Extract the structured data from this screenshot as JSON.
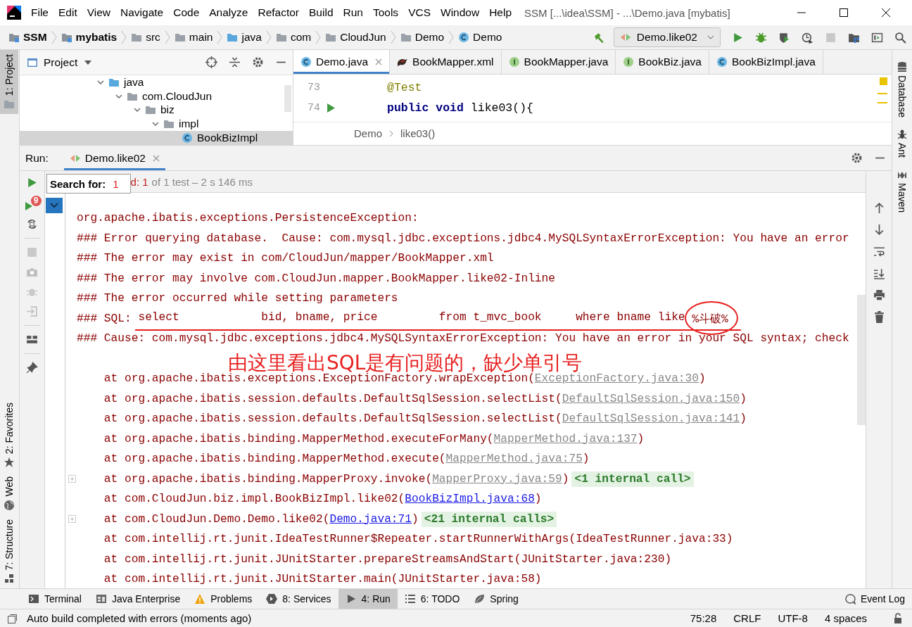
{
  "titlebar": {
    "menu": [
      "File",
      "Edit",
      "View",
      "Navigate",
      "Code",
      "Analyze",
      "Refactor",
      "Build",
      "Run",
      "Tools",
      "VCS",
      "Window",
      "Help"
    ],
    "title": "SSM [...\\idea\\SSM] - ...\\Demo.java [mybatis]"
  },
  "navbar": {
    "crumbs": [
      {
        "label": "SSM",
        "bold": true
      },
      {
        "label": "mybatis",
        "bold": true
      },
      {
        "label": "src",
        "bold": false
      },
      {
        "label": "main",
        "bold": false
      },
      {
        "label": "java",
        "bold": false
      },
      {
        "label": "com",
        "bold": false
      },
      {
        "label": "CloudJun",
        "bold": false
      },
      {
        "label": "Demo",
        "bold": false
      },
      {
        "label": "Demo",
        "bold": false
      }
    ],
    "run_config": "Demo.like02"
  },
  "project_panel": {
    "title": "Project",
    "tree": [
      {
        "label": "java",
        "expanded": true,
        "children": [
          {
            "label": "com.CloudJun",
            "expanded": true,
            "children": [
              {
                "label": "biz",
                "expanded": true,
                "children": [
                  {
                    "label": "impl",
                    "expanded": true,
                    "children": [
                      {
                        "label": "BookBizImpl"
                      }
                    ]
                  }
                ]
              }
            ]
          }
        ]
      }
    ]
  },
  "editor_tabs": [
    {
      "label": "Demo.java",
      "selected": true
    },
    {
      "label": "BookMapper.xml",
      "selected": false
    },
    {
      "label": "BookMapper.java",
      "selected": false
    },
    {
      "label": "BookBiz.java",
      "selected": false
    },
    {
      "label": "BookBizImpl.java",
      "selected": false
    }
  ],
  "editor_lines": [
    {
      "number": "73",
      "runnable": false,
      "tokens": [
        {
          "text": "@Test",
          "kind": "annotation"
        }
      ]
    },
    {
      "number": "74",
      "runnable": true,
      "tokens": [
        {
          "text": "public void",
          "kind": "keyword"
        },
        {
          "text": " like03(){",
          "kind": "plain"
        }
      ]
    }
  ],
  "editor_breadcrumb": [
    "Demo",
    "like03()"
  ],
  "run_panel": {
    "label": "Run:",
    "tab": "Demo.like02",
    "search_label": "Search for:",
    "search_value": "1",
    "status_fail": "d: 1",
    "status_rest": "of 1 test – 2 s 146 ms",
    "rerun_badge": "9"
  },
  "left_stripe": [
    {
      "label": "1: Project",
      "selected": true
    },
    {
      "label": "2: Favorites",
      "selected": false
    },
    {
      "label": "Web",
      "selected": false
    },
    {
      "label": "7: Structure",
      "selected": false
    }
  ],
  "right_stripe": [
    "Database",
    "Ant",
    "Maven"
  ],
  "console": [
    {
      "kind": "error",
      "text": "org.apache.ibatis.exceptions.PersistenceException:"
    },
    {
      "kind": "error",
      "text": "### Error querying database.  Cause: com.mysql.jdbc.exceptions.jdbc4.MySQLSyntaxErrorException: You have an error"
    },
    {
      "kind": "error",
      "text": "### The error may exist in com/CloudJun/mapper/BookMapper.xml"
    },
    {
      "kind": "error",
      "text": "### The error may involve com.CloudJun.mapper.BookMapper.like02-Inline"
    },
    {
      "kind": "error",
      "text": "### The error occurred while setting parameters"
    },
    {
      "kind": "sql",
      "prefix": "### SQL: ",
      "text": "select            bid, bname, price         from t_mvc_book     where bname like ",
      "circled": "%斗破%"
    },
    {
      "kind": "error",
      "text": "### Cause: com.mysql.jdbc.exceptions.jdbc4.MySQLSyntaxErrorException: You have an error in your SQL syntax; check"
    },
    {
      "kind": "note",
      "text": "由这里看出SQL是有问题的，缺少单引号"
    },
    {
      "kind": "trace",
      "text": "    at org.apache.ibatis.exceptions.ExceptionFactory.wrapException(",
      "link": "ExceptionFactory.java:30",
      "in_project": false,
      "tail": ")",
      "foldable": false
    },
    {
      "kind": "trace",
      "text": "    at org.apache.ibatis.session.defaults.DefaultSqlSession.selectList(",
      "link": "DefaultSqlSession.java:150",
      "in_project": false,
      "tail": ")",
      "foldable": false
    },
    {
      "kind": "trace",
      "text": "    at org.apache.ibatis.session.defaults.DefaultSqlSession.selectList(",
      "link": "DefaultSqlSession.java:141",
      "in_project": false,
      "tail": ")",
      "foldable": false
    },
    {
      "kind": "trace",
      "text": "    at org.apache.ibatis.binding.MapperMethod.executeForMany(",
      "link": "MapperMethod.java:137",
      "in_project": false,
      "tail": ")",
      "foldable": false
    },
    {
      "kind": "trace",
      "text": "    at org.apache.ibatis.binding.MapperMethod.execute(",
      "link": "MapperMethod.java:75",
      "in_project": false,
      "tail": ")",
      "foldable": false
    },
    {
      "kind": "trace",
      "text": "    at org.apache.ibatis.binding.MapperProxy.invoke(",
      "link": "MapperProxy.java:59",
      "in_project": false,
      "tail": ")",
      "foldable": true,
      "internal": "<1 internal call>"
    },
    {
      "kind": "trace",
      "text": "    at com.CloudJun.biz.impl.BookBizImpl.like02(",
      "link": "BookBizImpl.java:68",
      "in_project": true,
      "tail": ")",
      "foldable": false
    },
    {
      "kind": "trace",
      "text": "    at com.CloudJun.Demo.Demo.like02(",
      "link": "Demo.java:71",
      "in_project": true,
      "tail": ")",
      "foldable": true,
      "internal": "<21 internal calls>"
    },
    {
      "kind": "trace",
      "text": "    at com.intellij.rt.junit.IdeaTestRunner$Repeater.startRunnerWithArgs(IdeaTestRunner.java:33)",
      "foldable": false
    },
    {
      "kind": "trace",
      "text": "    at com.intellij.rt.junit.JUnitStarter.prepareStreamsAndStart(JUnitStarter.java:230)",
      "foldable": false
    },
    {
      "kind": "trace",
      "text": "    at com.intellij.rt.junit.JUnitStarter.main(JUnitStarter.java:58)",
      "foldable": false
    }
  ],
  "tool_windows": [
    {
      "label": "Terminal",
      "selected": false
    },
    {
      "label": "Java Enterprise",
      "selected": false
    },
    {
      "label": "Problems",
      "selected": false
    },
    {
      "label": "8: Services",
      "selected": false
    },
    {
      "label": "4: Run",
      "selected": true
    },
    {
      "label": "6: TODO",
      "selected": false
    },
    {
      "label": "Spring",
      "selected": false
    }
  ],
  "event_log": "Event Log",
  "status_bar": {
    "message": "Auto build completed with errors (moments ago)",
    "items": [
      "75:28",
      "CRLF",
      "UTF-8",
      "4 spaces"
    ]
  }
}
